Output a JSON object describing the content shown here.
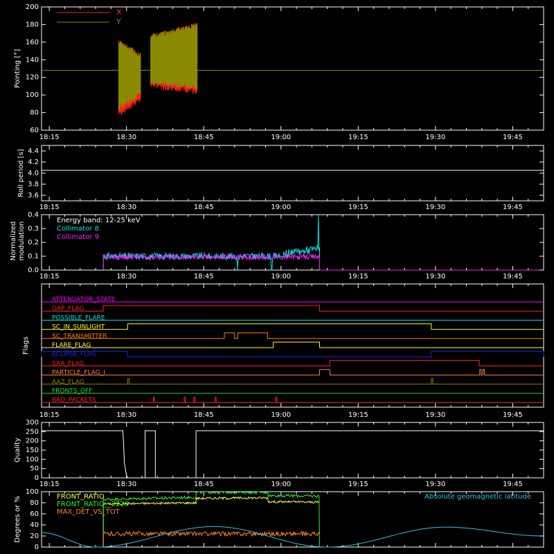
{
  "colors": {
    "background": "#000000",
    "axes": "#ffffff",
    "x": "#ff2020",
    "y": "#8a8a00",
    "roll": "#ffffff",
    "collimator8": "#00e6e6",
    "collimator9": "#ff20ff",
    "quality": "#ffffff",
    "front_ratio": "#ffff40",
    "front_ratio_2": "#20ff20",
    "max_det": "#ff8020",
    "geomag": "#20c8e0"
  },
  "x_axis": {
    "tick_labels": [
      "18:15",
      "18:30",
      "18:45",
      "19:00",
      "19:15",
      "19:30",
      "19:45"
    ],
    "tick_minutes": [
      15,
      30,
      45,
      60,
      75,
      90,
      105
    ],
    "domain_minutes": [
      13.5,
      111
    ]
  },
  "chart_data": [
    {
      "type": "line",
      "panel": "pointing",
      "ylabel": "Pointing [°]",
      "ylim": [
        60,
        200
      ],
      "yticks": [
        60,
        80,
        100,
        120,
        140,
        160,
        180,
        200
      ],
      "legend": [
        {
          "name": "X",
          "color": "#ff2020"
        },
        {
          "name": "Y",
          "color": "#8a8a00"
        }
      ],
      "segments": [
        {
          "start": 28.5,
          "end": 32.7,
          "x_low": [
            75,
            92
          ],
          "x_high": [
            163,
            148
          ],
          "y_low": [
            82,
            99
          ],
          "y_high": [
            163,
            148
          ]
        },
        {
          "start": 34.7,
          "end": 43.7,
          "x_low": [
            108,
            100
          ],
          "x_high": [
            169,
            182
          ],
          "y_low": [
            112,
            106
          ],
          "y_high": [
            169,
            182
          ]
        }
      ],
      "reference_line": {
        "series": "Y",
        "value": 128
      }
    },
    {
      "type": "line",
      "panel": "roll",
      "ylabel": "Roll period [s]",
      "ylim": [
        3.5,
        4.5
      ],
      "yticks": [
        3.6,
        3.8,
        4.0,
        4.2,
        4.4
      ],
      "value": 4.05
    },
    {
      "type": "line",
      "panel": "modulation",
      "ylabel": [
        "Normalized",
        "modulation"
      ],
      "ylim": [
        0,
        0.4
      ],
      "yticks": [
        0.0,
        0.1,
        0.2,
        0.3,
        0.4
      ],
      "annotation": "Energy band: 12-25 keV",
      "series": [
        {
          "name": "Collimator 8",
          "color": "#00e6e6",
          "start": 25.5,
          "end": 67.5,
          "base": 0.1,
          "noise": 0.025,
          "rise_from": 60,
          "rise_to": 0.15,
          "spike": {
            "x": 67.3,
            "value": 0.4
          },
          "dropouts": [
            51.5,
            58.2
          ]
        },
        {
          "name": "Collimator 9",
          "color": "#ff20ff",
          "start": 25.5,
          "end": 67.5,
          "base": 0.095,
          "noise": 0.02
        }
      ]
    },
    {
      "type": "step",
      "panel": "flags",
      "ylabel": "Flags",
      "flags": [
        {
          "name": "ATTENUATOR_STATE",
          "color": "#ff00ff",
          "changes": []
        },
        {
          "name": "GAP_FLAG",
          "color": "#ff2020",
          "changes": [
            [
              25.5,
              67.5
            ]
          ]
        },
        {
          "name": "POSSIBLE_FLARE",
          "color": "#00e0e0",
          "changes": []
        },
        {
          "name": "SC_IN_SUNLIGHT",
          "color": "#ffff00",
          "changes": [
            [
              30.2,
              89.2
            ]
          ]
        },
        {
          "name": "SC_TRANSMITTER",
          "color": "#ff8000",
          "changes": [
            [
              49,
              51
            ],
            [
              51.6,
              57.4
            ]
          ]
        },
        {
          "name": "FLARE_FLAG",
          "color": "#ffff40",
          "changes": [
            [
              58.5,
              67.5
            ]
          ]
        },
        {
          "name": "ECLIPSE_FLAG",
          "color": "#2020ff",
          "changes": [
            [
              13.5,
              30.2
            ],
            [
              89.2,
              111
            ]
          ]
        },
        {
          "name": "SAA_FLAG",
          "color": "#ff2020",
          "changes": [
            [
              69.5,
              98.5
            ]
          ]
        },
        {
          "name": "PARTICLE_FLAG_I",
          "color": "#ff8040",
          "changes": [
            [
              67.5,
              69.5
            ],
            [
              98.6,
              98.9
            ],
            [
              99.2,
              99.5
            ]
          ]
        },
        {
          "name": "AAZ_FLAG",
          "color": "#8a8a00",
          "changes": [
            [
              30.2,
              30.5
            ],
            [
              89.2,
              89.5
            ]
          ]
        },
        {
          "name": "FRONTS_OFF",
          "color": "#20e020",
          "changes": []
        },
        {
          "name": "BAD_PACKETS",
          "color": "#ff2020",
          "changes": [
            [
              35.2,
              35.4
            ],
            [
              41.2,
              41.4
            ],
            [
              43.1,
              43.3
            ],
            [
              47.2,
              47.4
            ],
            [
              59,
              59.2
            ]
          ]
        }
      ]
    },
    {
      "type": "step",
      "panel": "quality",
      "ylabel": "Quality",
      "ylim": [
        0,
        300
      ],
      "yticks": [
        0,
        50,
        100,
        150,
        200,
        250,
        300
      ],
      "points": [
        [
          13.5,
          255
        ],
        [
          29.3,
          255
        ],
        [
          29.6,
          80
        ],
        [
          30.0,
          10
        ],
        [
          30.3,
          0
        ],
        [
          33.6,
          0
        ],
        [
          33.6,
          255
        ],
        [
          35.6,
          255
        ],
        [
          35.6,
          0
        ],
        [
          43.5,
          0
        ],
        [
          43.5,
          255
        ],
        [
          111,
          255
        ]
      ]
    },
    {
      "type": "line",
      "panel": "ratios",
      "ylabel": "Degrees or %",
      "ylim": [
        0,
        100
      ],
      "yticks": [
        0,
        20,
        40,
        60,
        80,
        100
      ],
      "legend_right": "Absolute geomagnetic latitude",
      "series": [
        {
          "name": "FRONT_RATIO",
          "color": "#ffff40",
          "points": [
            [
              25.5,
              78
            ],
            [
              43.5,
              80
            ],
            [
              43.5,
              88
            ],
            [
              57.5,
              89
            ],
            [
              57.5,
              82
            ],
            [
              67.5,
              81
            ]
          ]
        },
        {
          "name": "FRONT_RATIO__2229",
          "color": "#20ff20",
          "points": [
            [
              25.5,
              86
            ],
            [
              43.5,
              90
            ],
            [
              43.5,
              99
            ],
            [
              57.5,
              99
            ],
            [
              57.5,
              93
            ],
            [
              67.5,
              92
            ],
            [
              67.5,
              0
            ]
          ]
        },
        {
          "name": "MAX_DET_VS_TOT",
          "color": "#ff8020",
          "points": [
            [
              25.5,
              24
            ],
            [
              67.5,
              24
            ]
          ]
        },
        {
          "name": "Absolute geomagnetic latitude",
          "color": "#20c8e0",
          "points": [
            [
              13.5,
              26
            ],
            [
              24,
              0
            ],
            [
              47,
              37
            ],
            [
              69,
              0
            ],
            [
              92,
              36
            ],
            [
              111,
              20
            ]
          ]
        }
      ]
    }
  ]
}
